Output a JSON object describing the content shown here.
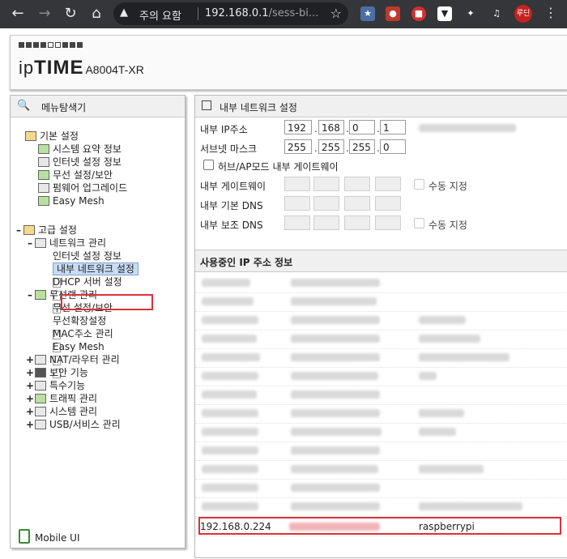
{
  "browser": {
    "security_label": "주의 요함",
    "url_host": "192.168.0.1",
    "url_path": "/sess-bi...",
    "profile_label": "루딘",
    "extensions": [
      "bookmark-ext-icon",
      "santa-ext-icon",
      "shield-ext-icon",
      "download-ext-icon",
      "puzzle-icon",
      "media-icon"
    ]
  },
  "header": {
    "brand_a": "ip",
    "brand_b": "TIME",
    "model": "A8004T-XR"
  },
  "nav": {
    "title": "메뉴탐색기",
    "basic_title": "기본 설정",
    "basic_items": [
      "시스템 요약 정보",
      "인터넷 설정 정보",
      "무선 설정/보안",
      "펌웨어 업그레이드",
      "Easy Mesh"
    ],
    "advanced_title": "고급 설정",
    "network_title": "네트워크 관리",
    "network_items": [
      "인터넷 설정 정보",
      "내부 네트워크 설정",
      "DHCP 서버 설정"
    ],
    "wireless_title": "무선랜 관리",
    "wireless_items": [
      "무선 설정/보안",
      "무선확장설정",
      "MAC주소 관리",
      "Easy Mesh"
    ],
    "other_items": [
      "NAT/라우터 관리",
      "보안 기능",
      "특수기능",
      "트래픽 관리",
      "시스템 관리",
      "USB/서비스 관리"
    ],
    "mobile": "Mobile UI"
  },
  "section": {
    "title": "내부 네트워크 설정",
    "ip_label": "내부 IP주소",
    "ip": [
      "192",
      "168",
      "0",
      "1"
    ],
    "mask_label": "서브넷 마스크",
    "mask": [
      "255",
      "255",
      "255",
      "0"
    ],
    "hub_label": "허브/AP모드 내부 게이트웨이",
    "gw_label": "내부 게이트웨이",
    "dns1_label": "내부 기본 DNS",
    "dns2_label": "내부 보조 DNS",
    "manual_label": "수동 지정"
  },
  "lease": {
    "title": "사용중인 IP 주소 정보",
    "visible_ip": "192.168.0.224",
    "visible_name": "raspberrypi"
  }
}
